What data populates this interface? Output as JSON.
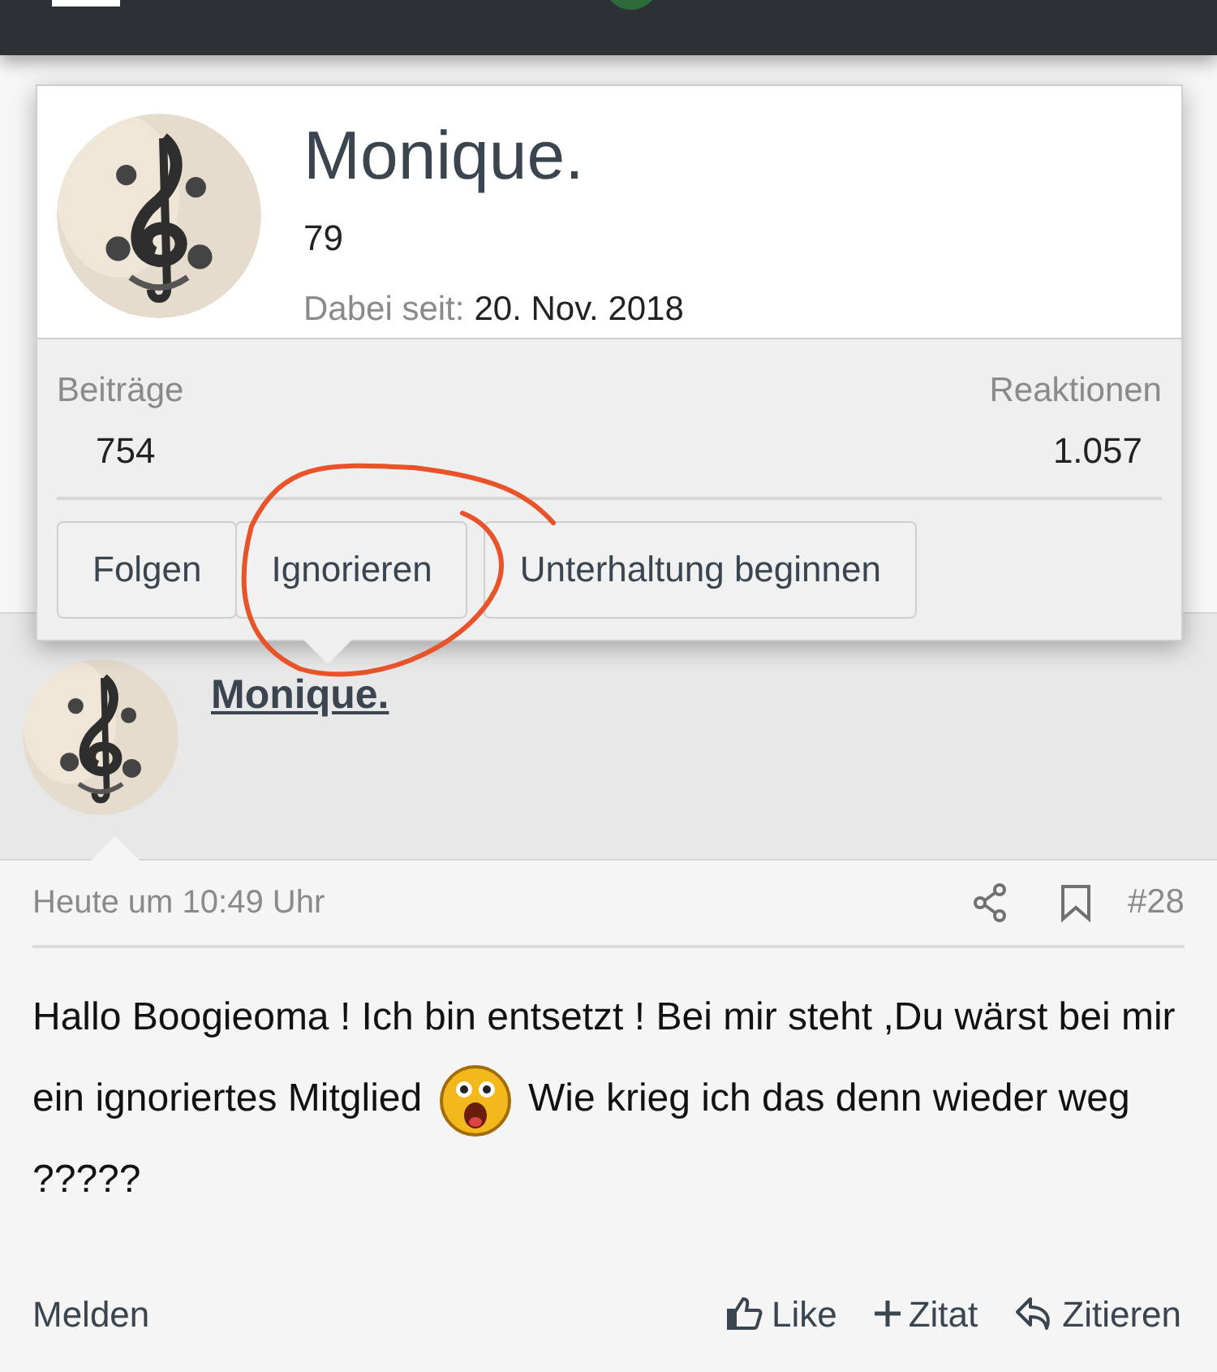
{
  "profile_card": {
    "name": "Monique.",
    "subtitle": "79",
    "joined_label": "Dabei seit:",
    "joined_date": "20. Nov. 2018",
    "stats": [
      {
        "label": "Beiträge",
        "value": "754"
      },
      {
        "label": "Reaktionen",
        "value": "1.057"
      }
    ],
    "buttons": [
      "Folgen",
      "Ignorieren",
      "Unterhaltung beginnen"
    ]
  },
  "post": {
    "author": "Monique.",
    "time": "Heute um 10:49 Uhr",
    "number": "#28",
    "body_before": "Hallo Boogieoma ! Ich bin entsetzt ! Bei mir steht ,Du wärst bei mir ein ignoriertes Mitglied",
    "body_after": "Wie krieg ich das denn wieder weg ?????",
    "report": "Melden",
    "actions": [
      {
        "kind": "like",
        "label": "Like"
      },
      {
        "kind": "add",
        "label": "Zitat"
      },
      {
        "kind": "reply",
        "label": "Zitieren"
      }
    ]
  }
}
